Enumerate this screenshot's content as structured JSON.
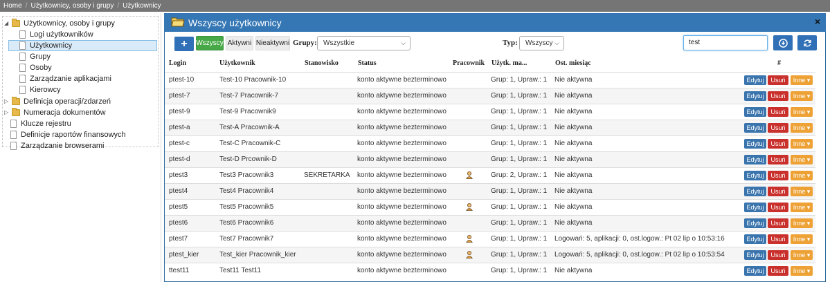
{
  "breadcrumb": [
    "Home",
    "Użytkownicy, osoby i grupy",
    "Użytkownicy"
  ],
  "tree": {
    "items": [
      {
        "label": "Użytkownicy, osoby i grupy",
        "type": "folder",
        "expanded": true
      },
      {
        "label": "Logi użytkowników",
        "type": "doc"
      },
      {
        "label": "Użytkownicy",
        "type": "doc",
        "selected": true
      },
      {
        "label": "Grupy",
        "type": "doc"
      },
      {
        "label": "Osoby",
        "type": "doc"
      },
      {
        "label": "Zarządzanie aplikacjami",
        "type": "doc"
      },
      {
        "label": "Kierowcy",
        "type": "doc"
      },
      {
        "label": "Definicja operacji/zdarzeń",
        "type": "folder",
        "expanded": false
      },
      {
        "label": "Numeracja dokumentów",
        "type": "folder",
        "expanded": false
      },
      {
        "label": "Klucze rejestru",
        "type": "doc"
      },
      {
        "label": "Definicje raportów finansowych",
        "type": "doc"
      },
      {
        "label": "Zarządzanie browserami",
        "type": "doc"
      }
    ]
  },
  "panel": {
    "title": "Wszyscy użytkownicy",
    "close": "×"
  },
  "toolbar": {
    "add": "+",
    "filters": [
      "Wszyscy",
      "Aktywni",
      "Nieaktywni"
    ],
    "groups_label": "Grupy:",
    "groups_value": "Wszystkie",
    "type_label": "Typ:",
    "type_value": "Wszyscy",
    "search_value": "test"
  },
  "table": {
    "headers": [
      "Login",
      "Użytkownik",
      "Stanowisko",
      "Status",
      "Pracownik",
      "Użytk. ma...",
      "Ost. miesiąc",
      "#"
    ],
    "actions": {
      "edit": "Edytuj",
      "delete": "Usuń",
      "more": "Inne ▾"
    },
    "rows": [
      {
        "login": "ptest-10",
        "user": "Test-10 Pracownik-10",
        "position": "",
        "status": "konto aktywne bezterminowo",
        "worker": false,
        "has": "Grup: 1, Upraw.: 1",
        "last": "Nie aktywna"
      },
      {
        "login": "ptest-7",
        "user": "Test-7 Pracownik-7",
        "position": "",
        "status": "konto aktywne bezterminowo",
        "worker": false,
        "has": "Grup: 1, Upraw.: 1",
        "last": "Nie aktywna"
      },
      {
        "login": "ptest-9",
        "user": "Test-9 Pracownik9",
        "position": "",
        "status": "konto aktywne bezterminowo",
        "worker": false,
        "has": "Grup: 1, Upraw.: 1",
        "last": "Nie aktywna"
      },
      {
        "login": "ptest-a",
        "user": "Test-A Pracownik-A",
        "position": "",
        "status": "konto aktywne bezterminowo",
        "worker": false,
        "has": "Grup: 1, Upraw.: 1",
        "last": "Nie aktywna"
      },
      {
        "login": "ptest-c",
        "user": "Test-C Pracownik-C",
        "position": "",
        "status": "konto aktywne bezterminowo",
        "worker": false,
        "has": "Grup: 1, Upraw.: 1",
        "last": "Nie aktywna"
      },
      {
        "login": "ptest-d",
        "user": "Test-D Prcownik-D",
        "position": "",
        "status": "konto aktywne bezterminowo",
        "worker": false,
        "has": "Grup: 1, Upraw.: 1",
        "last": "Nie aktywna"
      },
      {
        "login": "ptest3",
        "user": "Test3 Pracownik3",
        "position": "SEKRETARKA",
        "status": "konto aktywne bezterminowo",
        "worker": true,
        "has": "Grup: 2, Upraw.: 1",
        "last": "Nie aktywna"
      },
      {
        "login": "ptest4",
        "user": "Test4 Pracownik4",
        "position": "",
        "status": "konto aktywne bezterminowo",
        "worker": false,
        "has": "Grup: 1, Upraw.: 1",
        "last": "Nie aktywna"
      },
      {
        "login": "ptest5",
        "user": "Test5 Pracownik5",
        "position": "",
        "status": "konto aktywne bezterminowo",
        "worker": true,
        "has": "Grup: 1, Upraw.: 1",
        "last": "Nie aktywna"
      },
      {
        "login": "ptest6",
        "user": "Test6 Pracownik6",
        "position": "",
        "status": "konto aktywne bezterminowo",
        "worker": false,
        "has": "Grup: 1, Upraw.: 1",
        "last": "Nie aktywna"
      },
      {
        "login": "ptest7",
        "user": "Test7 Pracownik7",
        "position": "",
        "status": "konto aktywne bezterminowo",
        "worker": true,
        "has": "Grup: 1, Upraw.: 1",
        "last": "Logowań: 5, aplikacji: 0, ost.logow.: Pt 02 lip o 10:53:16"
      },
      {
        "login": "ptest_kier",
        "user": "Test_kier Pracownik_kier",
        "position": "",
        "status": "konto aktywne bezterminowo",
        "worker": true,
        "has": "Grup: 1, Upraw.: 1",
        "last": "Logowań: 5, aplikacji: 0, ost.logow.: Pt 02 lip o 10:53:54"
      },
      {
        "login": "ttest11",
        "user": "Test11 Test11",
        "position": "",
        "status": "konto aktywne bezterminowo",
        "worker": false,
        "has": "Grup: 1, Upraw.: 1",
        "last": "Nie aktywna"
      }
    ]
  },
  "colors": {
    "header": "#3477b4",
    "active_filter": "#46a846",
    "edit": "#3a74ad",
    "delete": "#c9302c",
    "more": "#eea236"
  }
}
